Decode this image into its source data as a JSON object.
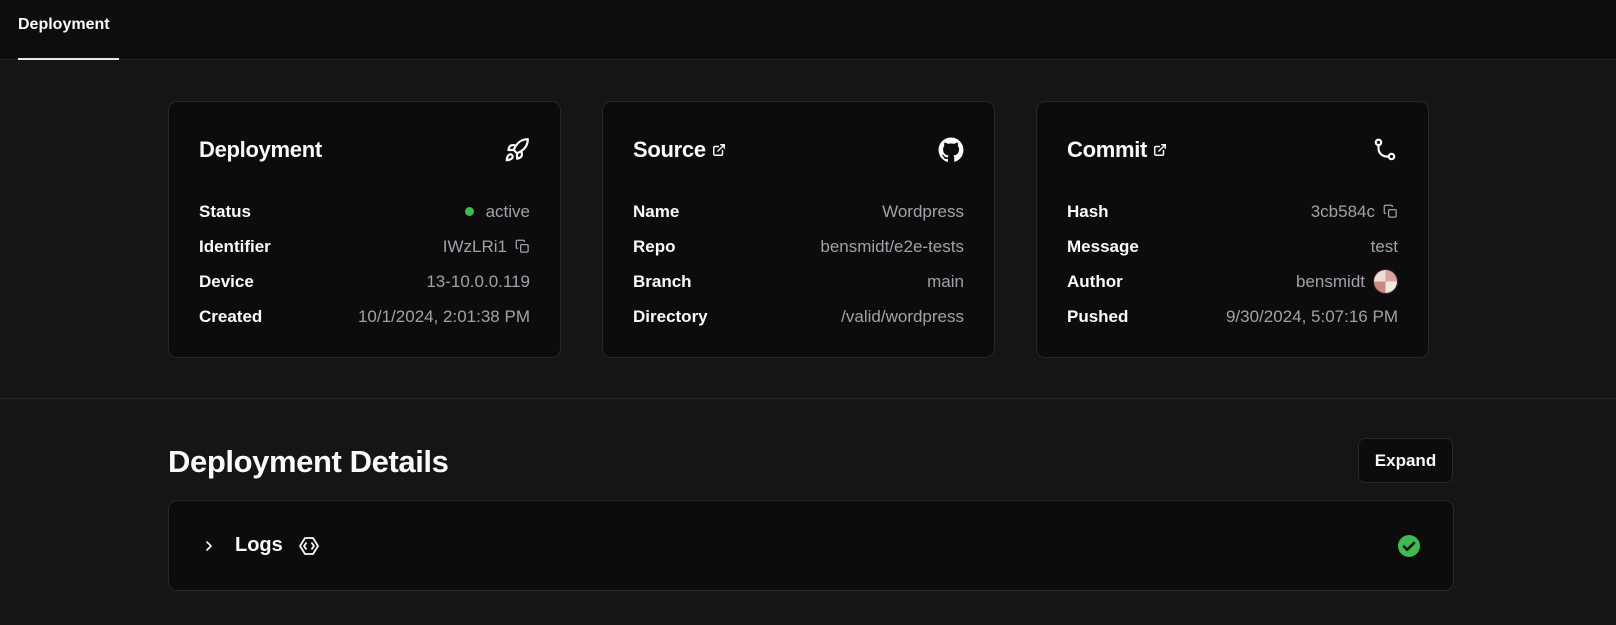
{
  "tabs": {
    "active_label": "Deployment"
  },
  "deployment_card": {
    "title": "Deployment",
    "icon": "rocket-icon",
    "rows": [
      {
        "label": "Status",
        "value": "active"
      },
      {
        "label": "Identifier",
        "value": "IWzLRi1"
      },
      {
        "label": "Device",
        "value": "13-10.0.0.119"
      },
      {
        "label": "Created",
        "value": "10/1/2024, 2:01:38 PM"
      }
    ]
  },
  "source_card": {
    "title": "Source",
    "icon": "github-icon",
    "rows": [
      {
        "label": "Name",
        "value": "Wordpress"
      },
      {
        "label": "Repo",
        "value": "bensmidt/e2e-tests"
      },
      {
        "label": "Branch",
        "value": "main"
      },
      {
        "label": "Directory",
        "value": "/valid/wordpress"
      }
    ]
  },
  "commit_card": {
    "title": "Commit",
    "icon": "git-commit-icon",
    "rows": [
      {
        "label": "Hash",
        "value": "3cb584c"
      },
      {
        "label": "Message",
        "value": "test"
      },
      {
        "label": "Author",
        "value": "bensmidt"
      },
      {
        "label": "Pushed",
        "value": "9/30/2024, 5:07:16 PM"
      }
    ]
  },
  "details": {
    "title": "Deployment Details",
    "expand_label": "Expand",
    "logs_label": "Logs",
    "logs_status": "success"
  },
  "colors": {
    "status_green": "#3fb950",
    "background": "#151517",
    "card": "#0c0c0d"
  }
}
